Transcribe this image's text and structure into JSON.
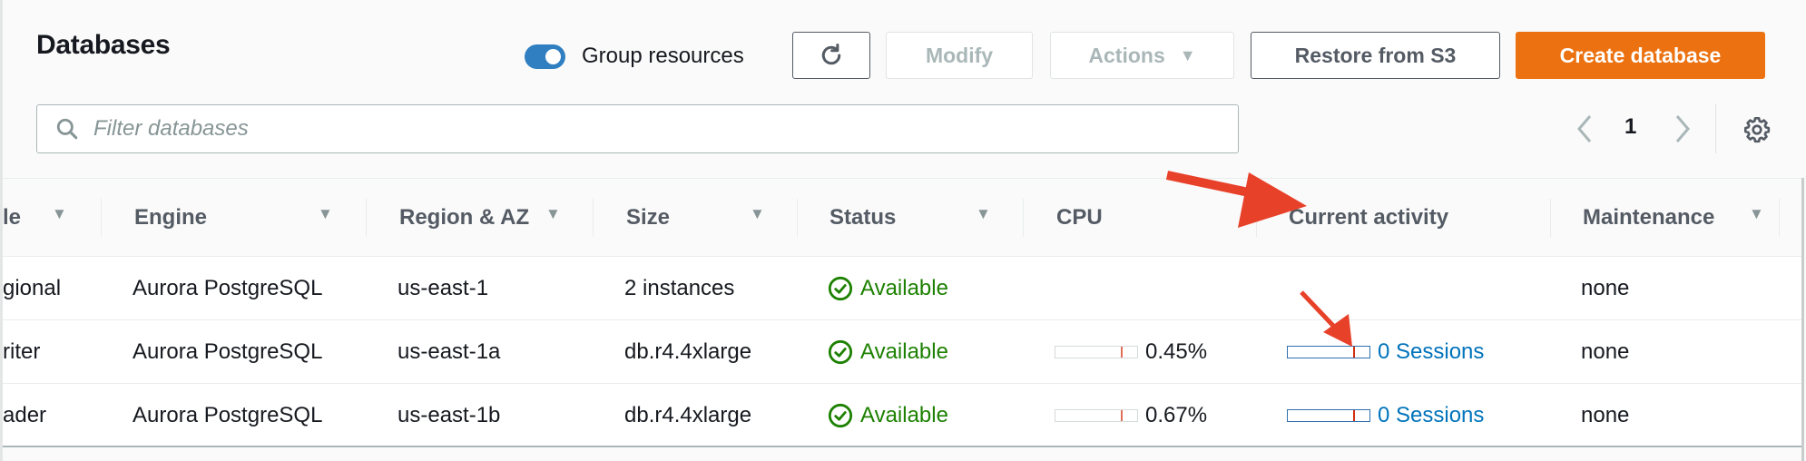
{
  "header": {
    "title": "Databases",
    "group_resources_label": "Group resources",
    "group_resources_enabled": true,
    "buttons": {
      "refresh_icon": "refresh-icon",
      "modify": "Modify",
      "actions": "Actions",
      "restore": "Restore from S3",
      "create": "Create database"
    }
  },
  "filter": {
    "placeholder": "Filter databases",
    "value": ""
  },
  "pagination": {
    "current_page": "1"
  },
  "table": {
    "columns": [
      {
        "label": "le",
        "sortable": true
      },
      {
        "label": "Engine",
        "sortable": true
      },
      {
        "label": "Region & AZ",
        "sortable": true
      },
      {
        "label": "Size",
        "sortable": true
      },
      {
        "label": "Status",
        "sortable": true
      },
      {
        "label": "CPU",
        "sortable": false
      },
      {
        "label": "Current activity",
        "sortable": false
      },
      {
        "label": "Maintenance",
        "sortable": true
      }
    ],
    "rows": [
      {
        "role": "gional",
        "engine": "Aurora PostgreSQL",
        "region": "us-east-1",
        "size": "2 instances",
        "status": "Available",
        "cpu": "",
        "cpu_fraction": null,
        "activity": "",
        "activity_fraction": null,
        "maintenance": "none"
      },
      {
        "role": "riter",
        "engine": "Aurora PostgreSQL",
        "region": "us-east-1a",
        "size": "db.r4.4xlarge",
        "status": "Available",
        "cpu": "0.45%",
        "cpu_fraction": 0.8,
        "activity": "0 Sessions",
        "activity_fraction": 0.8,
        "maintenance": "none"
      },
      {
        "role": "ader",
        "engine": "Aurora PostgreSQL",
        "region": "us-east-1b",
        "size": "db.r4.4xlarge",
        "status": "Available",
        "cpu": "0.67%",
        "cpu_fraction": 0.8,
        "activity": "0 Sessions",
        "activity_fraction": 0.8,
        "maintenance": "none"
      }
    ]
  },
  "colors": {
    "primary_orange": "#ec7211",
    "toggle_blue": "#2f7fc1",
    "status_green": "#1d8102",
    "link_blue": "#0073bb",
    "annotation_red": "#e8412a"
  }
}
